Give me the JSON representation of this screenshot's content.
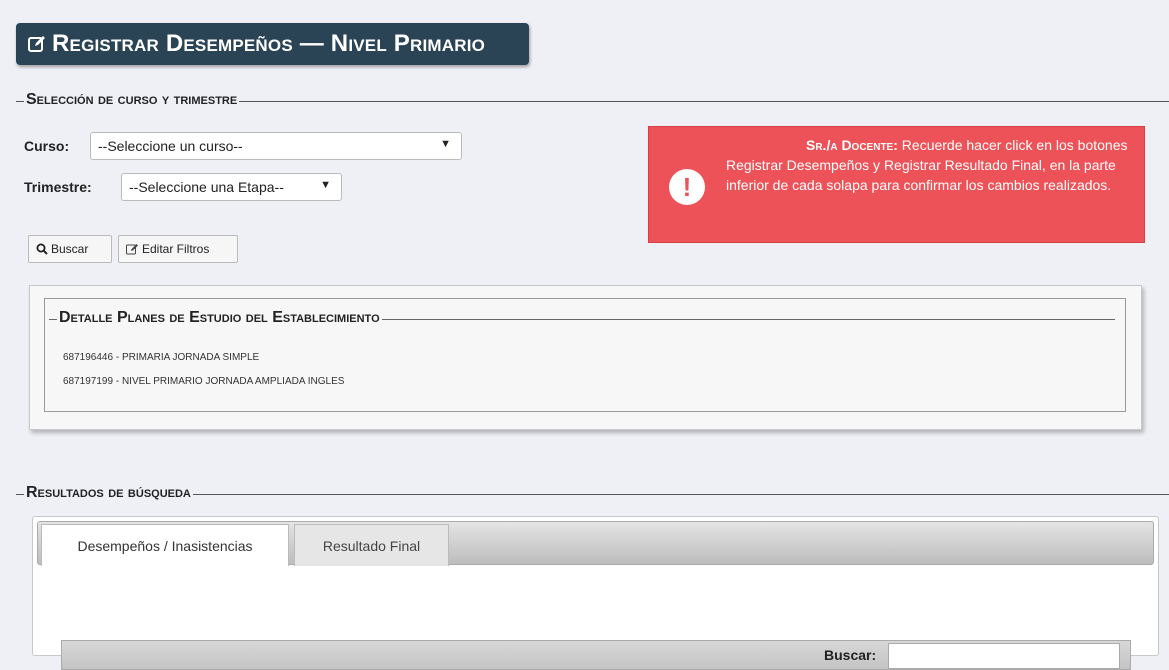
{
  "page": {
    "title": "Registrar Desempeños — Nivel Primario"
  },
  "selection": {
    "legend": "Selección de curso y trimestre",
    "curso_label": "Curso:",
    "curso_value": "--Seleccione un curso--",
    "trimestre_label": "Trimestre:",
    "trimestre_value": "--Seleccione una Etapa--",
    "buscar_button": "Buscar",
    "editar_button": "Editar Filtros"
  },
  "alert": {
    "heading": "Sr./a Docente:",
    "text": "Recuerde hacer click en los botones Registrar Desempeños y Registrar Resultado Final, en la parte inferior de cada solapa para confirmar los cambios realizados.",
    "icon": "exclamation-icon",
    "color": "#ec5257"
  },
  "planes": {
    "legend": "Detalle Planes de Estudio del Establecimiento",
    "items": [
      "687196446 - PRIMARIA JORNADA SIMPLE",
      "687197199 - NIVEL PRIMARIO JORNADA AMPLIADA INGLES"
    ]
  },
  "results": {
    "legend": "Resultados de búsqueda",
    "tabs": [
      {
        "label": "Desempeños / Inasistencias",
        "active": true
      },
      {
        "label": "Resultado Final",
        "active": false
      }
    ],
    "search_label": "Buscar:",
    "search_value": ""
  },
  "colors": {
    "title_bg": "#2a4355",
    "page_bg": "#eef0f6",
    "alert_bg": "#ec5257"
  }
}
